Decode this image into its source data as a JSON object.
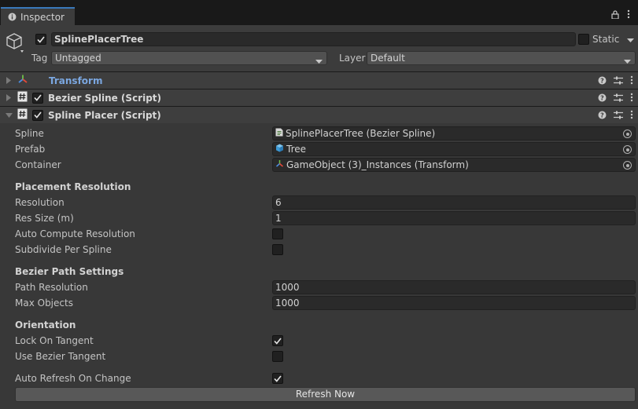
{
  "tab": {
    "title": "Inspector",
    "info_icon": "info-icon",
    "lock_icon": "lock-icon",
    "menu_icon": "kebab-menu-icon"
  },
  "object": {
    "name": "SplinePlacerTree",
    "active": true,
    "static_label": "Static",
    "static": false,
    "tag_label": "Tag",
    "tag_value": "Untagged",
    "layer_label": "Layer",
    "layer_value": "Default"
  },
  "components": [
    {
      "title": "Transform",
      "icon": "transform-axes-icon",
      "has_checkbox": false,
      "expanded": false,
      "title_color": "#7ba7e0"
    },
    {
      "title": "Bezier Spline (Script)",
      "icon": "script-hash-icon",
      "has_checkbox": true,
      "enabled": true,
      "expanded": false
    },
    {
      "title": "Spline Placer (Script)",
      "icon": "script-hash-icon",
      "has_checkbox": true,
      "enabled": true,
      "expanded": true
    }
  ],
  "fields": {
    "spline": {
      "label": "Spline",
      "value": "SplinePlacerTree (Bezier Spline)"
    },
    "prefab": {
      "label": "Prefab",
      "value": "Tree"
    },
    "container": {
      "label": "Container",
      "value": "GameObject (3)_Instances (Transform)"
    },
    "placement_header": "Placement Resolution",
    "resolution": {
      "label": "Resolution",
      "value": "6"
    },
    "res_size": {
      "label": "Res Size (m)",
      "value": "1"
    },
    "auto_compute": {
      "label": "Auto Compute Resolution",
      "checked": false
    },
    "subdivide": {
      "label": "Subdivide Per Spline",
      "checked": false
    },
    "bezier_header": "Bezier Path Settings",
    "path_resolution": {
      "label": "Path Resolution",
      "value": "1000"
    },
    "max_objects": {
      "label": "Max Objects",
      "value": "1000"
    },
    "orientation_header": "Orientation",
    "lock_tangent": {
      "label": "Lock On Tangent",
      "checked": true
    },
    "use_bezier_tangent": {
      "label": "Use Bezier Tangent",
      "checked": false
    },
    "auto_refresh": {
      "label": "Auto Refresh On Change",
      "checked": true
    },
    "refresh_button": "Refresh Now"
  },
  "colors": {
    "accent": "#3a79bb",
    "panel": "#383838",
    "header": "#3c3c3c",
    "transform_title": "#7ba7e0"
  }
}
